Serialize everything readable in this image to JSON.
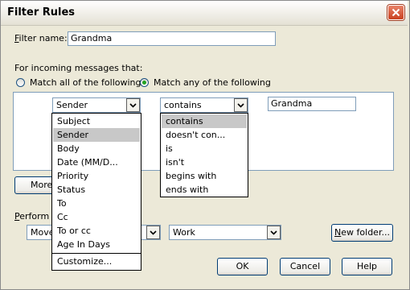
{
  "title": "Filter Rules",
  "filter_name": {
    "label": "Filter name:",
    "value": "Grandma"
  },
  "incoming": {
    "label": "For incoming messages that:",
    "match_all_label": "Match all of the following",
    "match_any_label": "Match any of the following",
    "selected": "any"
  },
  "rule": {
    "field": "Sender",
    "condition": "contains",
    "value": "Grandma"
  },
  "field_options": [
    "Subject",
    "Sender",
    "Body",
    "Date (MM/D...",
    "Priority",
    "Status",
    "To",
    "Cc",
    "To or cc",
    "Age In Days"
  ],
  "field_customize": "Customize...",
  "field_selected_index": 1,
  "condition_options": [
    "contains",
    "doesn't con...",
    "is",
    "isn't",
    "begins with",
    "ends with"
  ],
  "condition_selected_index": 0,
  "more_button": "More",
  "perform_label": "Perform th",
  "action": {
    "value": "Move"
  },
  "folder": {
    "value": "Work"
  },
  "buttons": {
    "new_folder": "New folder...",
    "ok": "OK",
    "cancel": "Cancel",
    "help": "Help"
  },
  "icons": {
    "close": "close-icon",
    "dropdown": "chevron-down-icon"
  }
}
